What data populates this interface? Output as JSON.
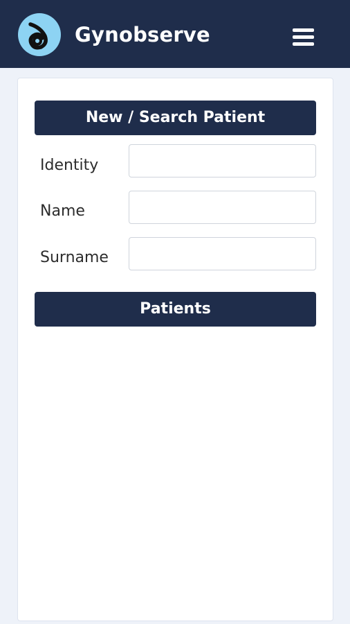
{
  "header": {
    "app_title": "Gynobserve",
    "logo_icon": "gynobserve-logo-icon",
    "menu_icon": "hamburger-menu-icon"
  },
  "search_section": {
    "title": "New / Search Patient",
    "fields": [
      {
        "label": "Identity",
        "value": "",
        "placeholder": ""
      },
      {
        "label": "Name",
        "value": "",
        "placeholder": ""
      },
      {
        "label": "Surname",
        "value": "",
        "placeholder": ""
      }
    ]
  },
  "patients_section": {
    "title": "Patients",
    "items": []
  },
  "colors": {
    "primary_navy": "#1f2d4b",
    "logo_blue": "#8dd3f3",
    "page_background": "#eef2f9"
  }
}
